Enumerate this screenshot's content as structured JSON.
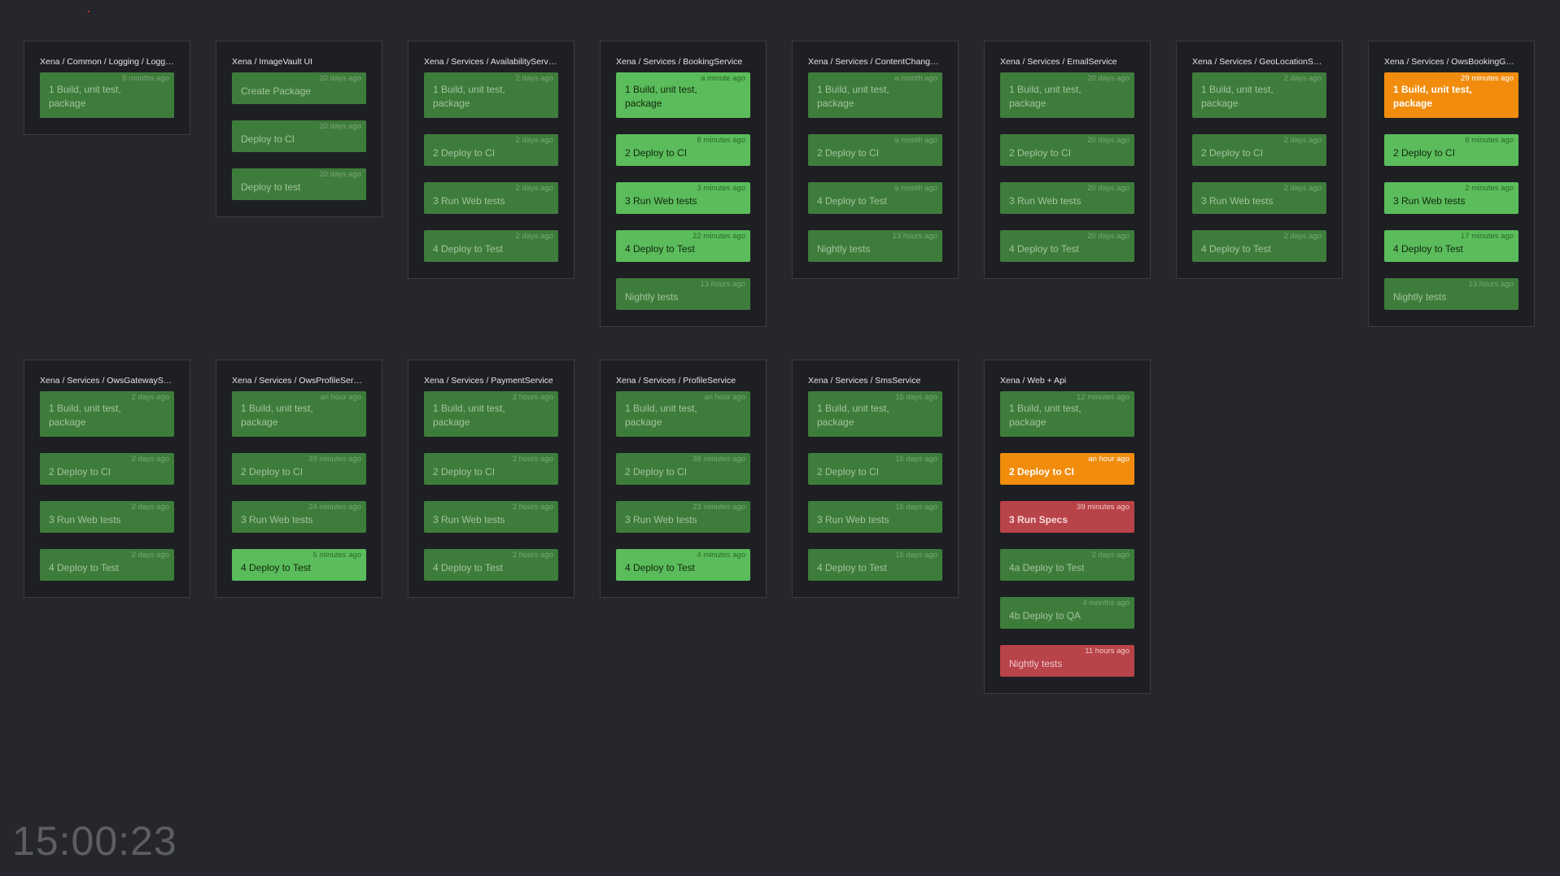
{
  "pipelines": [
    {
      "title": "Xena / Common / Logging / Logg…",
      "stages": [
        {
          "name": "1 Build, unit test,\npackage",
          "time": "6 months ago",
          "status": "passed"
        }
      ]
    },
    {
      "title": "Xena / ImageVault UI",
      "stages": [
        {
          "name": "Create Package",
          "time": "20 days ago",
          "status": "passed"
        },
        {
          "name": "Deploy to CI",
          "time": "20 days ago",
          "status": "passed"
        },
        {
          "name": "Deploy to test",
          "time": "20 days ago",
          "status": "passed"
        }
      ]
    },
    {
      "title": "Xena / Services / AvailabilityService",
      "stages": [
        {
          "name": "1 Build, unit test,\npackage",
          "time": "2 days ago",
          "status": "passed"
        },
        {
          "name": "2 Deploy to CI",
          "time": "2 days ago",
          "status": "passed"
        },
        {
          "name": "3 Run Web tests",
          "time": "2 days ago",
          "status": "passed"
        },
        {
          "name": "4 Deploy to Test",
          "time": "2 days ago",
          "status": "passed"
        }
      ]
    },
    {
      "title": "Xena / Services / BookingService",
      "stages": [
        {
          "name": "1 Build, unit test,\npackage",
          "time": "a minute ago",
          "status": "recent"
        },
        {
          "name": "2 Deploy to CI",
          "time": "8 minutes ago",
          "status": "recent"
        },
        {
          "name": "3 Run Web tests",
          "time": "3 minutes ago",
          "status": "recent"
        },
        {
          "name": "4 Deploy to Test",
          "time": "22 minutes ago",
          "status": "recent"
        },
        {
          "name": "Nightly tests",
          "time": "13 hours ago",
          "status": "passed"
        }
      ]
    },
    {
      "title": "Xena / Services / ContentChang…",
      "stages": [
        {
          "name": "1 Build, unit test,\npackage",
          "time": "a month ago",
          "status": "passed"
        },
        {
          "name": "2 Deploy to CI",
          "time": "a month ago",
          "status": "passed"
        },
        {
          "name": "4 Deploy to Test",
          "time": "a month ago",
          "status": "passed"
        },
        {
          "name": "Nightly tests",
          "time": "13 hours ago",
          "status": "passed"
        }
      ]
    },
    {
      "title": "Xena / Services / EmailService",
      "stages": [
        {
          "name": "1 Build, unit test,\npackage",
          "time": "20 days ago",
          "status": "passed"
        },
        {
          "name": "2 Deploy to CI",
          "time": "20 days ago",
          "status": "passed"
        },
        {
          "name": "3 Run Web tests",
          "time": "20 days ago",
          "status": "passed"
        },
        {
          "name": "4 Deploy to Test",
          "time": "20 days ago",
          "status": "passed"
        }
      ]
    },
    {
      "title": "Xena / Services / GeoLocationSe…",
      "stages": [
        {
          "name": "1 Build, unit test,\npackage",
          "time": "2 days ago",
          "status": "passed"
        },
        {
          "name": "2 Deploy to CI",
          "time": "2 days ago",
          "status": "passed"
        },
        {
          "name": "3 Run Web tests",
          "time": "2 days ago",
          "status": "passed"
        },
        {
          "name": "4 Deploy to Test",
          "time": "2 days ago",
          "status": "passed"
        }
      ]
    },
    {
      "title": "Xena / Services / OwsBookingGa…",
      "stages": [
        {
          "name": "1 Build, unit test,\npackage",
          "time": "29 minutes ago",
          "status": "building"
        },
        {
          "name": "2 Deploy to CI",
          "time": "6 minutes ago",
          "status": "recent"
        },
        {
          "name": "3 Run Web tests",
          "time": "2 minutes ago",
          "status": "recent"
        },
        {
          "name": "4 Deploy to Test",
          "time": "17 minutes ago",
          "status": "recent"
        },
        {
          "name": "Nightly tests",
          "time": "13 hours ago",
          "status": "passed"
        }
      ]
    },
    {
      "title": "Xena / Services / OwsGatewayS…",
      "stages": [
        {
          "name": "1 Build, unit test,\npackage",
          "time": "2 days ago",
          "status": "passed"
        },
        {
          "name": "2 Deploy to CI",
          "time": "2 days ago",
          "status": "passed"
        },
        {
          "name": "3 Run Web tests",
          "time": "2 days ago",
          "status": "passed"
        },
        {
          "name": "4 Deploy to Test",
          "time": "2 days ago",
          "status": "passed"
        }
      ]
    },
    {
      "title": "Xena / Services / OwsProfileService",
      "stages": [
        {
          "name": "1 Build, unit test,\npackage",
          "time": "an hour ago",
          "status": "passed"
        },
        {
          "name": "2 Deploy to CI",
          "time": "39 minutes ago",
          "status": "passed"
        },
        {
          "name": "3 Run Web tests",
          "time": "24 minutes ago",
          "status": "passed"
        },
        {
          "name": "4 Deploy to Test",
          "time": "5 minutes ago",
          "status": "recent"
        }
      ]
    },
    {
      "title": "Xena / Services / PaymentService",
      "stages": [
        {
          "name": "1 Build, unit test,\npackage",
          "time": "2 hours ago",
          "status": "passed"
        },
        {
          "name": "2 Deploy to CI",
          "time": "2 hours ago",
          "status": "passed"
        },
        {
          "name": "3 Run Web tests",
          "time": "2 hours ago",
          "status": "passed"
        },
        {
          "name": "4 Deploy to Test",
          "time": "2 hours ago",
          "status": "passed"
        }
      ]
    },
    {
      "title": "Xena / Services / ProfileService",
      "stages": [
        {
          "name": "1 Build, unit test,\npackage",
          "time": "an hour ago",
          "status": "passed"
        },
        {
          "name": "2 Deploy to CI",
          "time": "38 minutes ago",
          "status": "passed"
        },
        {
          "name": "3 Run Web tests",
          "time": "23 minutes ago",
          "status": "passed"
        },
        {
          "name": "4 Deploy to Test",
          "time": "4 minutes ago",
          "status": "recent"
        }
      ]
    },
    {
      "title": "Xena / Services / SmsService",
      "stages": [
        {
          "name": "1 Build, unit test,\npackage",
          "time": "15 days ago",
          "status": "passed"
        },
        {
          "name": "2 Deploy to CI",
          "time": "15 days ago",
          "status": "passed"
        },
        {
          "name": "3 Run Web tests",
          "time": "15 days ago",
          "status": "passed"
        },
        {
          "name": "4 Deploy to Test",
          "time": "15 days ago",
          "status": "passed"
        }
      ]
    },
    {
      "title": "Xena / Web + Api",
      "stages": [
        {
          "name": "1 Build, unit test,\npackage",
          "time": "12 minutes ago",
          "status": "passed"
        },
        {
          "name": "2 Deploy to CI",
          "time": "an hour ago",
          "status": "building"
        },
        {
          "name": "3 Run Specs",
          "time": "39 minutes ago",
          "status": "failed-bold"
        },
        {
          "name": "4a Deploy to Test",
          "time": "2 days ago",
          "status": "passed"
        },
        {
          "name": "4b Deploy to QA",
          "time": "4 months ago",
          "status": "passed"
        },
        {
          "name": "Nightly tests",
          "time": "11 hours ago",
          "status": "failed"
        }
      ]
    }
  ],
  "clock": "15:00:23",
  "colors": {
    "background": "#25272c",
    "panel": "#1d1f23",
    "passed": "#3e7c3c",
    "recent": "#5bbc5b",
    "building": "#f18c0d",
    "failed": "#b84348"
  }
}
